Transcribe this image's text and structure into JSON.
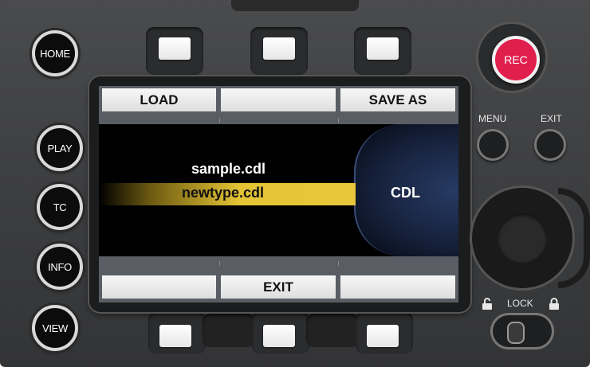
{
  "device": {
    "left_buttons": [
      {
        "label": "HOME"
      },
      {
        "label": "PLAY"
      },
      {
        "label": "TC"
      },
      {
        "label": "INFO"
      },
      {
        "label": "VIEW"
      }
    ],
    "rec_label": "REC",
    "menu_label": "MENU",
    "exit_label": "EXIT",
    "lock_label": "LOCK"
  },
  "screen": {
    "top_tabs": [
      "LOAD",
      "",
      "SAVE AS"
    ],
    "bottom_tabs": [
      "",
      "EXIT",
      ""
    ],
    "files": [
      "sample.cdl",
      "newtype.cdl"
    ],
    "selected_file": "newtype.cdl",
    "mode_label": "CDL"
  },
  "colors": {
    "rec": "#e11f4d",
    "selection": "#e5c535",
    "screen_panel": "#263a63"
  }
}
